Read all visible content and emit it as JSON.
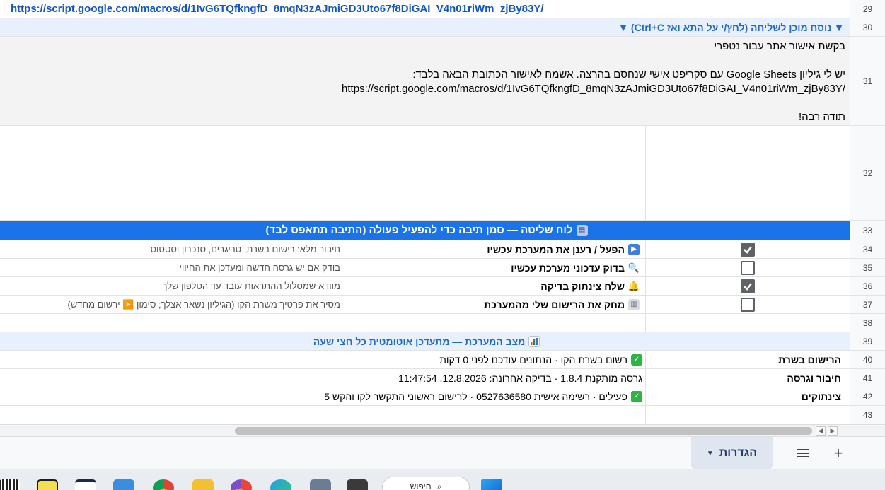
{
  "sheet": {
    "rows": {
      "r29": {
        "num": "29",
        "url": "https://script.google.com/macros/d/1IvG6TQfkngfD_8mqN3zAJmiGD3Uto67f8DiGAI_V4n01riWm_zjBy83Y/"
      },
      "r30": {
        "num": "30",
        "title": "▼ נוסח מוכן לשליחה (לחץ/י על התא ואז Ctrl+C) ▼"
      },
      "r31": {
        "num": "31",
        "line1": "בקשת אישור אתר עבור נטפרי",
        "line2": "יש לי גיליון Google Sheets עם סקריפט אישי שנחסם בהרצה. אשמח לאישור הכתובת הבאה בלבד:",
        "line3": "https://script.google.com/macros/d/1IvG6TQfkngfD_8mqN3zAJmiGD3Uto67f8DiGAI_V4n01riWm_zjBy83Y/",
        "line4": "תודה רבה!"
      },
      "r32": {
        "num": "32"
      },
      "r33": {
        "num": "33",
        "title": "לוח שליטה — סמן תיבה כדי להפעיל פעולה (התיבה תתאפס לבד)"
      },
      "r34": {
        "num": "34",
        "checked": true,
        "action": "הפעל / רענן את המערכת עכשיו",
        "desc": "חיבור מלא: רישום בשרת, טריגרים, סנכרון וסטטוס"
      },
      "r35": {
        "num": "35",
        "checked": false,
        "action": "בדוק עדכוני מערכת עכשיו",
        "desc": "בודק אם יש גרסה חדשה ומעדכן את החיווי"
      },
      "r36": {
        "num": "36",
        "checked": true,
        "action": "שלח צינתוק בדיקה",
        "desc": "מוודא שמסלול ההתראות עובד עד הטלפון שלך"
      },
      "r37": {
        "num": "37",
        "checked": false,
        "action": "מחק את הרישום שלי מהמערכת",
        "desc": "מסיר את פרטיך משרת הקו (הגיליון נשאר אצלך; סימון ▶️ ירשום מחדש)"
      },
      "r38": {
        "num": "38"
      },
      "r39": {
        "num": "39",
        "title": "מצב המערכת — מתעדכן אוטומטית כל חצי שעה"
      },
      "r40": {
        "num": "40",
        "label": "הרישום בשרת",
        "value": "רשום בשרת הקו · הנתונים עודכנו לפני 0 דקות"
      },
      "r41": {
        "num": "41",
        "label": "חיבור וגרסה",
        "value": "גרסה מותקנת 1.8.4 · בדיקה אחרונה: 12.8.2026, 11:47:54"
      },
      "r42": {
        "num": "42",
        "label": "צינתוקים",
        "value": "פעילים · רשימה אישית 0527636580 · לרישום ראשוני התקשר לקו והקש 5"
      },
      "r43": {
        "num": "43"
      }
    }
  },
  "sheetbar": {
    "tab_label": "הגדרות"
  },
  "taskbar": {
    "search_text": "חיפוש"
  },
  "colors": {
    "header_blue": "#1a73e8",
    "header_light": "#e8f0fe",
    "link": "#1155cc",
    "checkbox": "#5f6368",
    "check_green": "#2eb345"
  }
}
